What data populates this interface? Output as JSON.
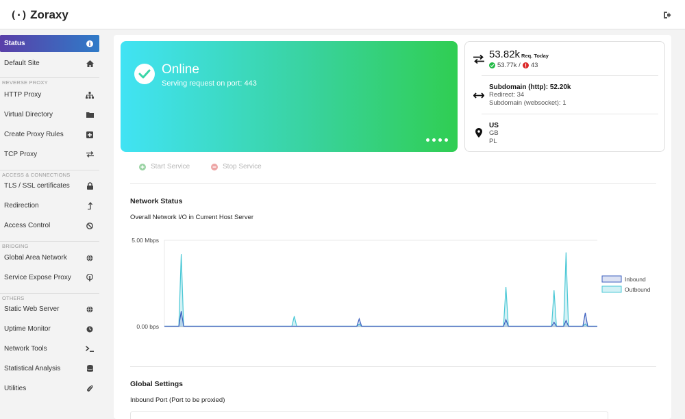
{
  "app": {
    "name": "Zoraxy",
    "logo_mark": "(·)"
  },
  "sidebar": {
    "items": [
      {
        "label": "Status",
        "icon": "info-icon",
        "active": true
      },
      {
        "label": "Default Site",
        "icon": "home-icon"
      },
      {
        "label": "HTTP Proxy",
        "icon": "sitemap-icon"
      },
      {
        "label": "Virtual Directory",
        "icon": "folder-icon"
      },
      {
        "label": "Create Proxy Rules",
        "icon": "plus-square-icon"
      },
      {
        "label": "TCP Proxy",
        "icon": "exchange-icon"
      },
      {
        "label": "TLS / SSL certificates",
        "icon": "lock-icon"
      },
      {
        "label": "Redirection",
        "icon": "level-up-icon"
      },
      {
        "label": "Access Control",
        "icon": "ban-icon"
      },
      {
        "label": "Global Area Network",
        "icon": "globe-icon"
      },
      {
        "label": "Service Expose Proxy",
        "icon": "podcast-icon"
      },
      {
        "label": "Static Web Server",
        "icon": "globe-icon"
      },
      {
        "label": "Uptime Monitor",
        "icon": "clock-icon"
      },
      {
        "label": "Network Tools",
        "icon": "terminal-icon"
      },
      {
        "label": "Statistical Analysis",
        "icon": "database-icon"
      },
      {
        "label": "Utilities",
        "icon": "paperclip-icon"
      }
    ],
    "sections": [
      "REVERSE PROXY",
      "ACCESS & CONNECTIONS",
      "BRIDGING",
      "OTHERS"
    ]
  },
  "status": {
    "title": "Online",
    "subtitle": "Serving request on port: 443"
  },
  "stats": {
    "requests": "53.82k",
    "requests_label": "Req. Today",
    "success": "53.77k /",
    "errors": "43",
    "subdomain": "Subdomain (http): 52.20k",
    "redirect": "Redirect: 34",
    "websocket": "Subdomain (websocket): 1",
    "countries": [
      "US",
      "GB",
      "PL"
    ]
  },
  "service": {
    "start_label": "Start Service",
    "stop_label": "Stop Service"
  },
  "network": {
    "title": "Network Status",
    "subtitle": "Overall Network I/O in Current Host Server"
  },
  "global_settings": {
    "title": "Global Settings",
    "inbound_label": "Inbound Port (Port to be proxied)"
  },
  "colors": {
    "accent_gradient_start": "#5a3fa8",
    "accent_gradient_end": "#2f7bc8",
    "online_gradient_start": "#41e3f4",
    "online_gradient_end": "#30ce52",
    "inbound": "#3b5fbf",
    "outbound": "#4bc8d6"
  },
  "chart_data": {
    "type": "line",
    "y_tick_labels": [
      "5.00 Mbps",
      "0.00 bps"
    ],
    "ylim": [
      0,
      5
    ],
    "y_unit": "Mbps",
    "legend": "right",
    "series": [
      {
        "name": "Inbound",
        "peaks": [
          [
            7,
            0.9
          ],
          [
            81,
            0.45
          ],
          [
            142,
            0.4
          ],
          [
            162,
            0.25
          ],
          [
            167,
            0.35
          ],
          [
            175,
            0.8
          ]
        ]
      },
      {
        "name": "Outbound",
        "peaks": [
          [
            7,
            4.2
          ],
          [
            54,
            0.6
          ],
          [
            81,
            0.15
          ],
          [
            142,
            2.3
          ],
          [
            162,
            2.1
          ],
          [
            167,
            4.3
          ],
          [
            175,
            0.15
          ]
        ]
      }
    ],
    "x_count": 181
  }
}
